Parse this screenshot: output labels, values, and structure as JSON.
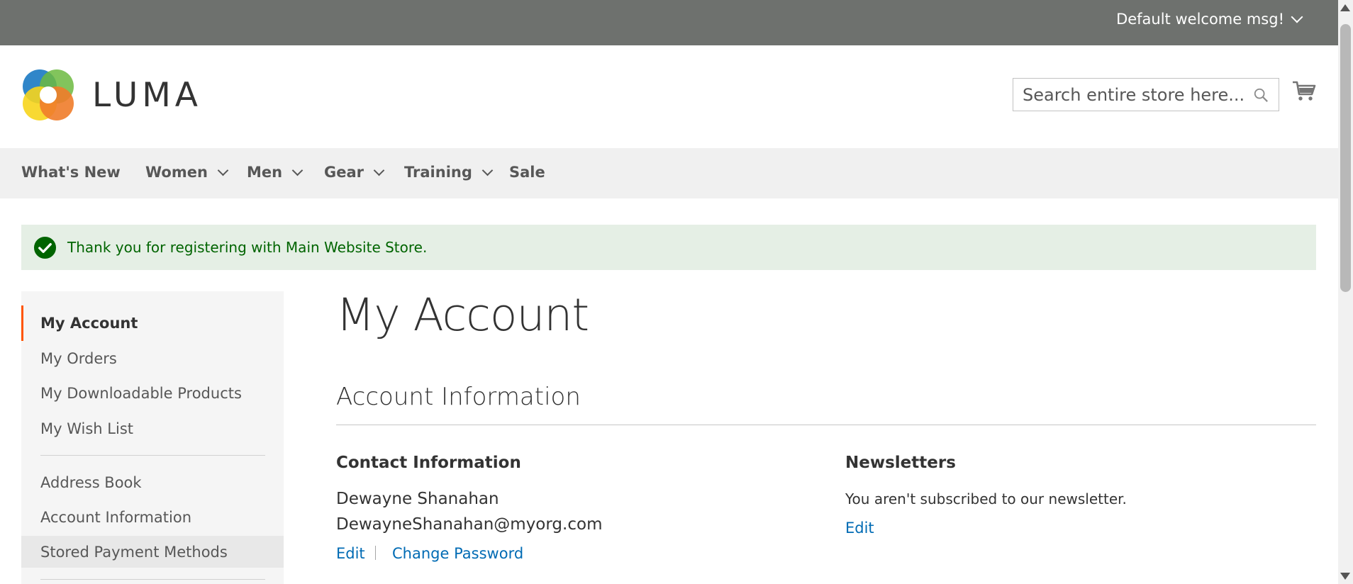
{
  "topbar": {
    "welcome": "Default welcome msg!"
  },
  "header": {
    "logo_text": "LUMA",
    "search_placeholder": "Search entire store here..."
  },
  "nav": {
    "items": [
      {
        "label": "What's New",
        "has_dropdown": false
      },
      {
        "label": "Women",
        "has_dropdown": true
      },
      {
        "label": "Men",
        "has_dropdown": true
      },
      {
        "label": "Gear",
        "has_dropdown": true
      },
      {
        "label": "Training",
        "has_dropdown": true
      },
      {
        "label": "Sale",
        "has_dropdown": false
      }
    ]
  },
  "message": {
    "text": "Thank you for registering with Main Website Store.",
    "type": "success"
  },
  "sidebar": {
    "items": [
      {
        "label": "My Account",
        "active": true
      },
      {
        "label": "My Orders"
      },
      {
        "label": "My Downloadable Products"
      },
      {
        "label": "My Wish List"
      },
      {
        "label": "Address Book"
      },
      {
        "label": "Account Information"
      },
      {
        "label": "Stored Payment Methods"
      }
    ]
  },
  "main": {
    "title": "My Account",
    "section_title": "Account Information",
    "contact": {
      "title": "Contact Information",
      "name": "Dewayne Shanahan",
      "email": "DewayneShanahan@myorg.com",
      "edit_label": "Edit",
      "change_password_label": "Change Password"
    },
    "newsletters": {
      "title": "Newsletters",
      "text": "You aren't subscribed to our newsletter.",
      "edit_label": "Edit"
    }
  },
  "colors": {
    "topbar": "#6e716e",
    "nav_bg": "#f0f0f0",
    "success_bg": "#e5efe5",
    "success_text": "#006400",
    "link": "#006bb4",
    "active_accent": "#ff5501"
  }
}
